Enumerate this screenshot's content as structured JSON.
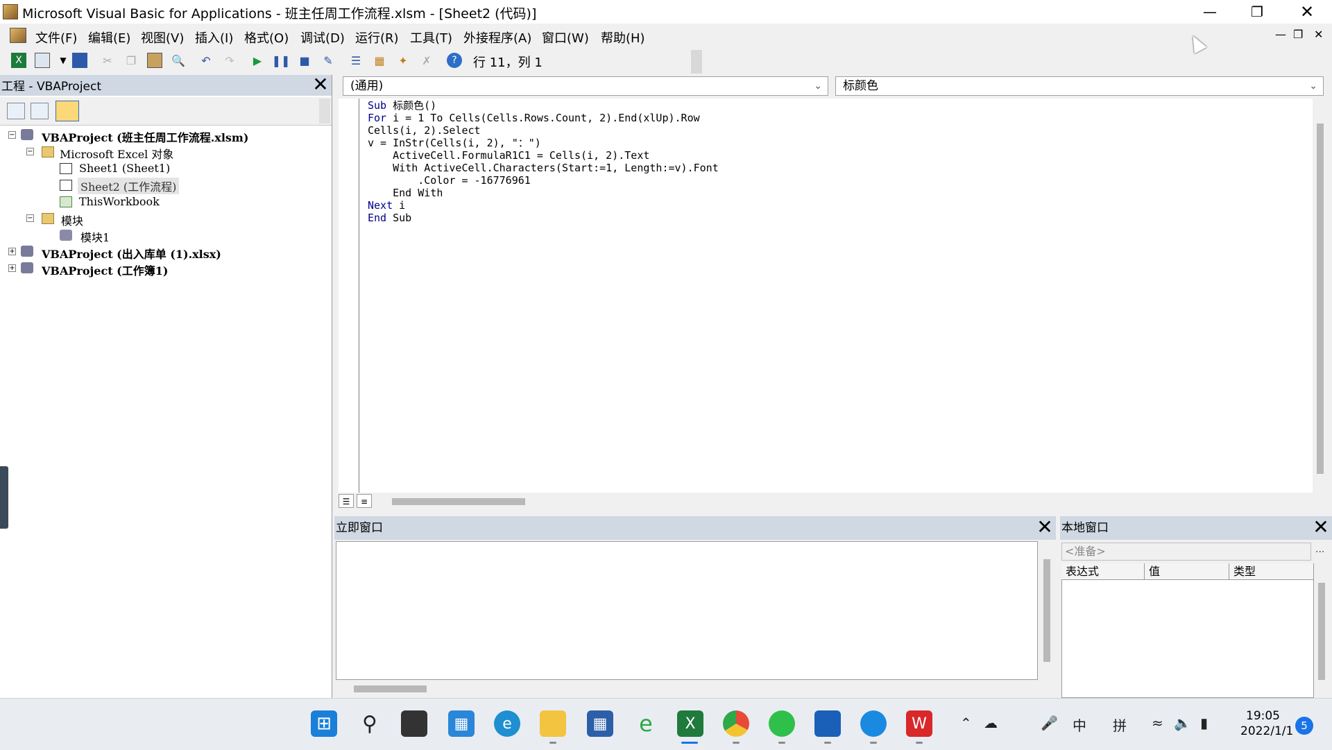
{
  "window": {
    "title": "Microsoft Visual Basic for Applications - 班主任周工作流程.xlsm - [Sheet2 (代码)]",
    "minimize_icon": "minimize-icon",
    "restore_icon": "restore-icon",
    "close_icon": "close-icon"
  },
  "menu": {
    "items": [
      "文件(F)",
      "编辑(E)",
      "视图(V)",
      "插入(I)",
      "格式(O)",
      "调试(D)",
      "运行(R)",
      "工具(T)",
      "外接程序(A)",
      "窗口(W)",
      "帮助(H)"
    ]
  },
  "toolbar": {
    "position": "行 11，列 1"
  },
  "project": {
    "title": "工程 - VBAProject",
    "tree": {
      "p1": "VBAProject (班主任周工作流程.xlsm)",
      "excel_objects": "Microsoft Excel 对象",
      "sheet1": "Sheet1 (Sheet1)",
      "sheet2": "Sheet2 (工作流程)",
      "thisworkbook": "ThisWorkbook",
      "modules": "模块",
      "module1": "模块1",
      "p2": "VBAProject (出入库单 (1).xlsx)",
      "p3": "VBAProject (工作簿1)"
    }
  },
  "code": {
    "object_combo": "(通用)",
    "proc_combo": "标颜色",
    "lines": [
      {
        "k": "Sub",
        "t": " 标颜色()"
      },
      {
        "k": "For",
        "t": " i = 1 To Cells(Cells.Rows.Count, 2).End(xlUp).Row"
      },
      {
        "k": "",
        "t": "Cells(i, 2).Select"
      },
      {
        "k": "",
        "t": "v = InStr(Cells(i, 2), \"：\")"
      },
      {
        "k": "",
        "t": "    ActiveCell.FormulaR1C1 = Cells(i, 2).Text"
      },
      {
        "k": "",
        "t": "    With ActiveCell.Characters(Start:=1, Length:=v).Font"
      },
      {
        "k": "",
        "t": "        .Color = -16776961"
      },
      {
        "k": "",
        "t": "    End With"
      },
      {
        "k": "Next",
        "t": " i"
      },
      {
        "k": "End",
        "t": " Sub"
      }
    ]
  },
  "immediate": {
    "title": "立即窗口"
  },
  "locals": {
    "title": "本地窗口",
    "context": "<准备>",
    "ellipsis": "...",
    "columns": [
      "表达式",
      "值",
      "类型"
    ]
  },
  "taskbar": {
    "time": "19:05",
    "date": "2022/1/1",
    "ime_mode": "中",
    "ime_pinyin": "拼",
    "notifications": "5"
  },
  "colors": {
    "panel_header": "#cfd8e3",
    "keyword": "#00008b"
  }
}
